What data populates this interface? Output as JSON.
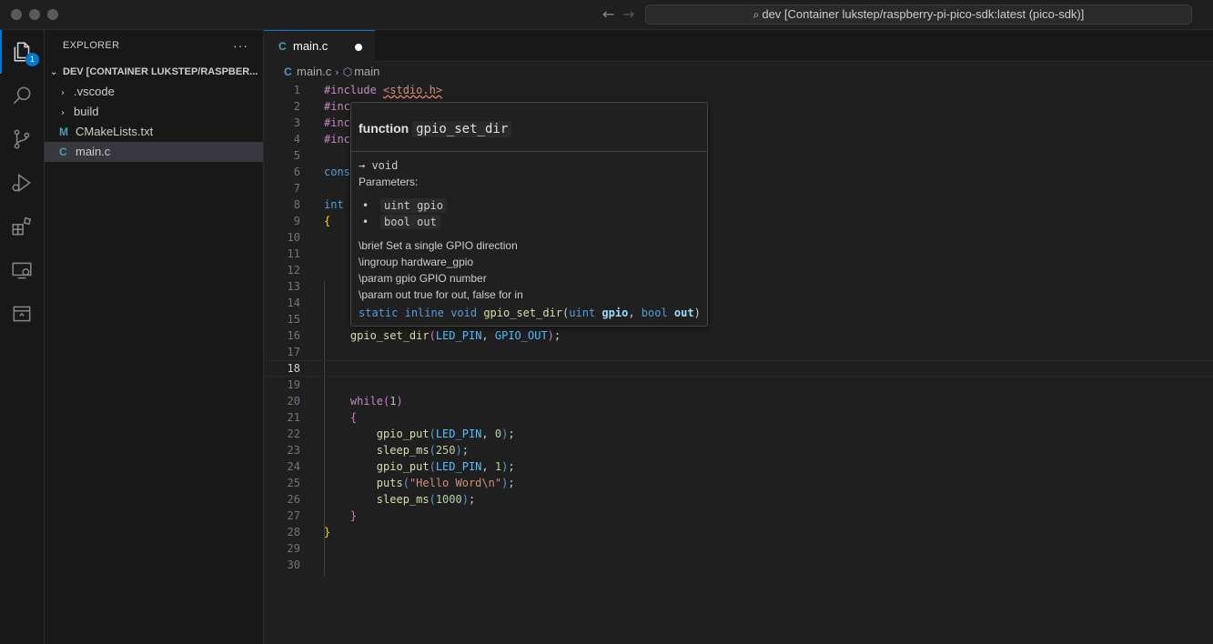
{
  "window": {
    "command_center": "dev [Container lukstep/raspberry-pi-pico-sdk:latest (pico-sdk)]",
    "nav_back": "←",
    "nav_forward": "→",
    "search_glyph": "⌕"
  },
  "activity_bar": {
    "items": [
      "explorer-icon",
      "search-icon",
      "source-control-icon",
      "run-debug-icon",
      "extensions-icon",
      "remote-explorer-icon",
      "containers-icon"
    ],
    "explorer_badge": "1"
  },
  "sidebar": {
    "title": "EXPLORER",
    "more": "···",
    "workspace": "DEV [CONTAINER LUKSTEP/RASPBER...",
    "items": [
      {
        "label": ".vscode",
        "kind": "folder"
      },
      {
        "label": "build",
        "kind": "folder"
      },
      {
        "label": "CMakeLists.txt",
        "kind": "file",
        "icon": "M"
      },
      {
        "label": "main.c",
        "kind": "file",
        "icon": "C"
      }
    ]
  },
  "editor": {
    "tab": {
      "label": "main.c",
      "icon": "C"
    },
    "breadcrumb": {
      "file": "main.c",
      "symbol": "main",
      "file_icon": "C"
    },
    "line_numbers": [
      "1",
      "2",
      "3",
      "4",
      "5",
      "6",
      "7",
      "8",
      "9",
      "10",
      "11",
      "12",
      "13",
      "14",
      "15",
      "16",
      "17",
      "18",
      "19",
      "20",
      "21",
      "22",
      "23",
      "24",
      "25",
      "26",
      "27",
      "28",
      "29",
      "30"
    ],
    "current_line": "18"
  },
  "hover": {
    "kind": "function",
    "name": "gpio_set_dir",
    "returns": "→ void",
    "params_title": "Parameters:",
    "params": [
      "uint gpio",
      "bool out"
    ],
    "doc": [
      "\\brief Set a single GPIO direction",
      "\\ingroup hardware_gpio",
      "\\param gpio GPIO number",
      "\\param out true for out, false for in"
    ],
    "signature": {
      "static": "static",
      "inline": "inline",
      "void": "void",
      "fn": "gpio_set_dir",
      "uint": "uint",
      "gpio": "gpio",
      "bool": "bool",
      "out": "out"
    }
  },
  "code": {
    "l1_inc": "#include",
    "l1_hdr": "<stdio.h>",
    "l2": "#inc",
    "l3": "#inc",
    "l4": "#inc",
    "l6": "cons",
    "l8": "int",
    "l16_fn": "gpio_set_dir",
    "l16_arg1": "LED_PIN",
    "l16_arg2": "GPIO_OUT",
    "l20_kw": "while",
    "l20_num": "1",
    "l22_fn": "gpio_put",
    "l22_arg": "LED_PIN",
    "l22_num": "0",
    "l23_fn": "sleep_ms",
    "l23_num": "250",
    "l24_fn": "gpio_put",
    "l24_arg": "LED_PIN",
    "l24_num": "1",
    "l25_fn": "puts",
    "l25_str": "\"Hello Word\\n\"",
    "l26_fn": "sleep_ms",
    "l26_num": "1000"
  },
  "colors": {
    "accent": "#0078d4",
    "keyword": "#569cd6",
    "function": "#dcdcaa",
    "string": "#ce9178",
    "number": "#b5cea8",
    "macro": "#4fc1ff",
    "control": "#c586c0"
  }
}
